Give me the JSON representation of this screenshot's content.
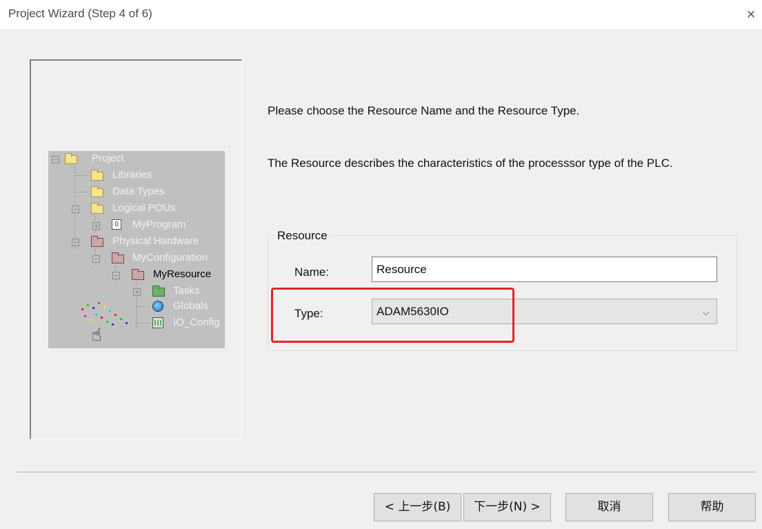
{
  "window": {
    "title": "Project Wizard (Step 4 of 6)"
  },
  "tree": {
    "items": [
      {
        "label": "Project"
      },
      {
        "label": "Libraries"
      },
      {
        "label": "Data Types"
      },
      {
        "label": "Logical POUs"
      },
      {
        "label": "MyProgram"
      },
      {
        "label": "Physical Hardware"
      },
      {
        "label": "MyConfiguration"
      },
      {
        "label": "MyResource"
      },
      {
        "label": "Tasks"
      },
      {
        "label": "Globals"
      },
      {
        "label": "IO_Config"
      }
    ],
    "pou_icon_text": "0"
  },
  "messages": {
    "line1": "Please choose the Resource Name and the Resource Type.",
    "line2": "The Resource describes the characteristics of the processsor type of the PLC."
  },
  "resource": {
    "group_label": "Resource",
    "name_label": "Name:",
    "name_value": "Resource",
    "type_label": "Type:",
    "type_value": "ADAM5630IO"
  },
  "buttons": {
    "back": "< 上一步(B)",
    "next": "下一步(N) >",
    "cancel": "取消",
    "help": "帮助"
  },
  "colors": {
    "highlight": "#e8202a",
    "tree_bg": "#c0c0c0"
  },
  "icons": {
    "close": "×",
    "chevron": "⌄",
    "hand": "☝"
  }
}
